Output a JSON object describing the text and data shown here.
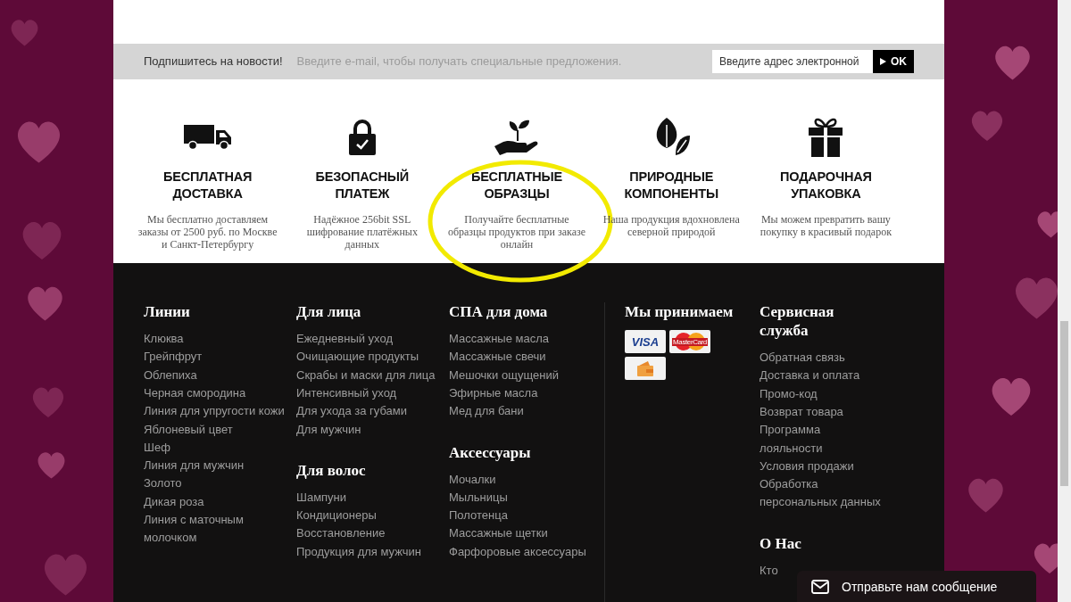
{
  "newsletter": {
    "title": "Подпишитесь на новости!",
    "hint": "Введите e-mail, чтобы получать специальные предложения.",
    "email_field": {
      "placeholder": "Введите адрес электронной"
    },
    "submit": "OK"
  },
  "features": [
    {
      "kind": "truck",
      "title": "БЕСПЛАТНАЯ ДОСТАВКА",
      "text": "Мы бесплатно доставляем заказы от 2500 руб. по Москве и Санкт-Петербургу",
      "highlighted": false
    },
    {
      "kind": "lock",
      "title": "БЕЗОПАСНЫЙ ПЛАТЕЖ",
      "text": "Надёжное 256bit SSL шифрование платёжных данных",
      "highlighted": false
    },
    {
      "kind": "plant",
      "title": "БЕСПЛАТНЫЕ ОБРАЗЦЫ",
      "text": "Получайте бесплатные образцы продуктов при заказе онлайн",
      "highlighted": true
    },
    {
      "kind": "leaves",
      "title": "ПРИРОДНЫЕ КОМПОНЕНТЫ",
      "text": "Наша продукция вдохновлена северной природой",
      "highlighted": false
    },
    {
      "kind": "gift",
      "title": "ПОДАРОЧНАЯ УПАКОВКА",
      "text": "Мы можем превратить вашу покупку в красивый подарок",
      "highlighted": false
    }
  ],
  "footer_columns": [
    {
      "sections": [
        {
          "heading": "Линии",
          "links": [
            "Клюква",
            "Грейпфрут",
            "Облепиха",
            "Черная смородина",
            "Линия для упругости кожи",
            "Яблоневый цвет",
            "Шеф",
            "Линия для мужчин",
            "Золото",
            "Дикая роза",
            "Линия с маточным молочком"
          ]
        }
      ]
    },
    {
      "sections": [
        {
          "heading": "Для лица",
          "links": [
            "Ежедневный уход",
            "Очищающие продукты",
            "Скрабы и маски для лица",
            "Интенсивный уход",
            "Для ухода за губами",
            "Для мужчин"
          ]
        },
        {
          "heading": "Для волос",
          "links": [
            "Шампуни",
            "Кондиционеры",
            "Восстановление",
            "Продукция для мужчин"
          ]
        }
      ]
    },
    {
      "sections": [
        {
          "heading": "СПА для дома",
          "links": [
            "Массажные масла",
            "Массажные свечи",
            "Мешочки ощущений",
            "Эфирные масла",
            "Мед для бани"
          ]
        },
        {
          "heading": "Аксессуары",
          "links": [
            "Мочалки",
            "Мыльницы",
            "Полотенца",
            "Массажные щетки",
            "Фарфоровые аксессуары"
          ]
        }
      ]
    }
  ],
  "payments": {
    "heading": "Мы принимаем",
    "cards": [
      {
        "kind": "visa",
        "label": "VISA"
      },
      {
        "kind": "mastercard",
        "label": "MasterCard"
      },
      {
        "kind": "wallet"
      }
    ]
  },
  "service": {
    "heading": "Сервисная служба",
    "links": [
      "Обратная связь",
      "Доставка и оплата",
      "Промо-код",
      "Возврат товара",
      "Программа лояльности",
      "Условия продажи",
      "Обработка персональных данных"
    ]
  },
  "about": {
    "heading": "О Нас",
    "links": [
      "Кто"
    ]
  },
  "chat_button": "Отправьте нам сообщение"
}
